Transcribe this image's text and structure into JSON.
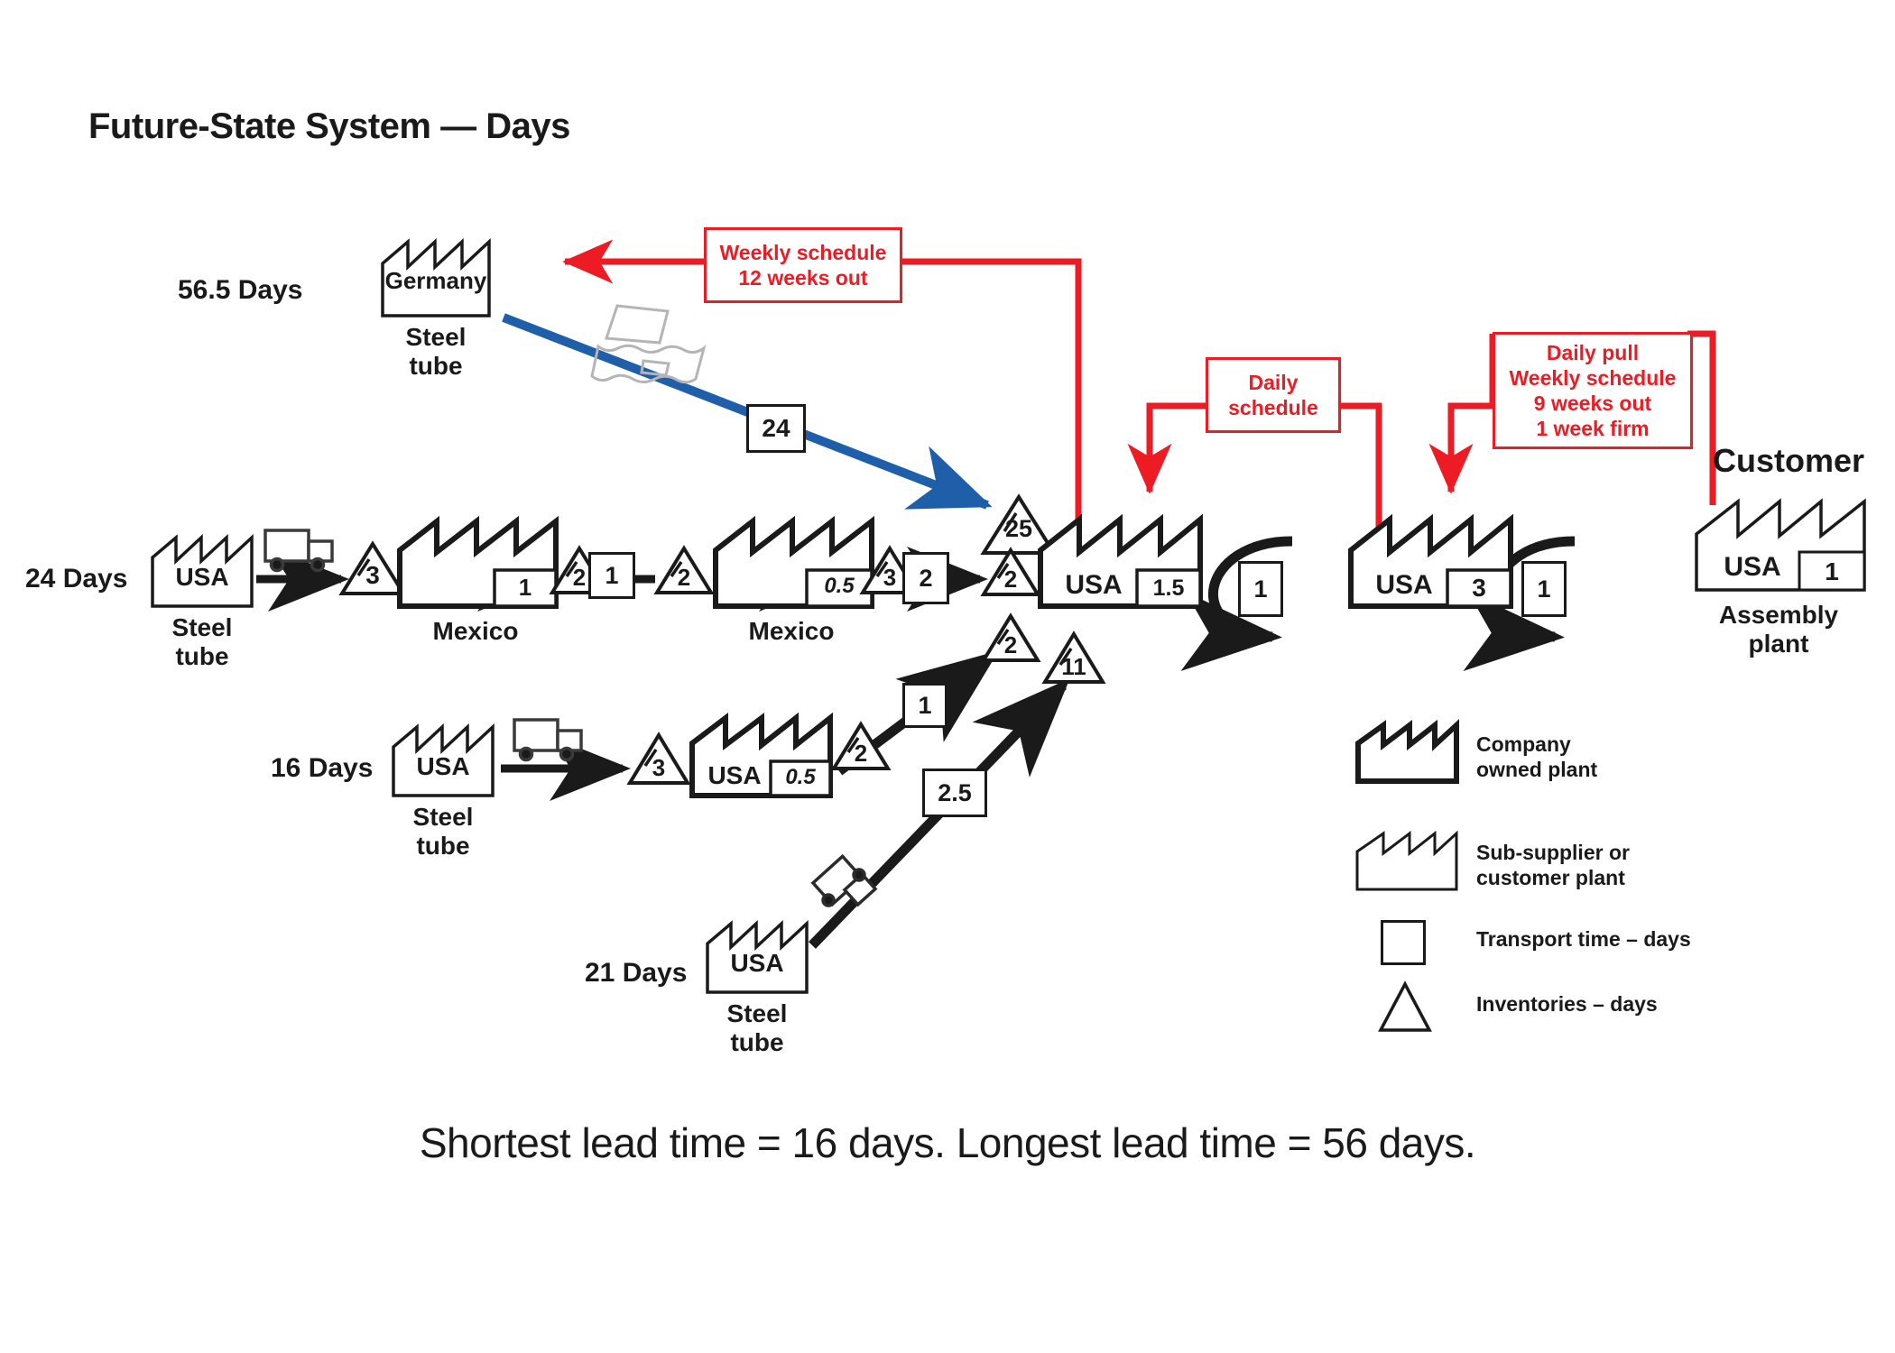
{
  "title": "Future-State System — Days",
  "caption": "Shortest lead time = 16 days. Longest lead time = 56 days.",
  "colors": {
    "schedule_red": "#ed1c24",
    "ship_blue": "#1f5fa9",
    "line_black": "#1a1a1a"
  },
  "branches": {
    "germany": {
      "lead_time_label": "56.5 Days",
      "supplier_label": "Germany",
      "supplier_sub": "Steel\ntube",
      "transport_days": "24",
      "transport_mode": "ship-icon",
      "arriving_inventory": "25"
    },
    "usa_main": {
      "lead_time_label": "24 Days",
      "supplier_label": "USA",
      "supplier_sub": "Steel\ntube",
      "transport_mode": "truck-icon",
      "steps": [
        {
          "type": "inventory",
          "value": "3"
        },
        {
          "type": "plant",
          "country": "Mexico",
          "cycle": "1",
          "owned": true
        },
        {
          "type": "inventory",
          "value": "2"
        },
        {
          "type": "transport",
          "value": "1"
        },
        {
          "type": "inventory",
          "value": "2"
        },
        {
          "type": "plant",
          "country": "Mexico",
          "cycle": "0.5",
          "owned": true
        },
        {
          "type": "inventory",
          "value": "3"
        },
        {
          "type": "transport",
          "value": "2"
        },
        {
          "type": "inventory",
          "value": "2"
        }
      ]
    },
    "usa_16": {
      "lead_time_label": "16 Days",
      "supplier_label": "USA",
      "supplier_sub": "Steel\ntube",
      "transport_mode": "truck-icon",
      "steps": [
        {
          "type": "inventory",
          "value": "3"
        },
        {
          "type": "plant",
          "country": "USA",
          "cycle": "0.5",
          "owned": true
        },
        {
          "type": "inventory",
          "value": "2"
        },
        {
          "type": "transport",
          "value": "1"
        }
      ],
      "merge_inventory": "2"
    },
    "usa_21": {
      "lead_time_label": "21 Days",
      "supplier_label": "USA",
      "supplier_sub": "Steel\ntube",
      "transport_mode": "truck-icon",
      "transport_days": "2.5",
      "merge_inventory": "11"
    }
  },
  "mainline": {
    "plants": [
      {
        "country": "USA",
        "cycle": "1.5"
      },
      {
        "country": "USA",
        "cycle": "3"
      },
      {
        "country": "USA",
        "cycle": "1"
      }
    ],
    "loops": [
      {
        "value": "1"
      },
      {
        "value": "1"
      }
    ],
    "customer_label": "Customer",
    "assembly_label": "Assembly\nplant"
  },
  "schedule_boxes": [
    {
      "id": "weekly-12",
      "lines": [
        "Weekly schedule",
        "12 weeks out"
      ]
    },
    {
      "id": "daily",
      "lines": [
        "Daily",
        "schedule"
      ]
    },
    {
      "id": "daily-pull",
      "lines": [
        "Daily pull",
        "Weekly schedule",
        "9 weeks out",
        "1 week firm"
      ]
    }
  ],
  "legend": [
    {
      "icon": "company-plant-icon",
      "label": "Company\nowned plant"
    },
    {
      "icon": "sub-supplier-plant-icon",
      "label": "Sub-supplier or\ncustomer plant"
    },
    {
      "icon": "transport-box-icon",
      "label": "Transport time – days"
    },
    {
      "icon": "inventory-triangle-icon",
      "label": "Inventories – days"
    }
  ]
}
